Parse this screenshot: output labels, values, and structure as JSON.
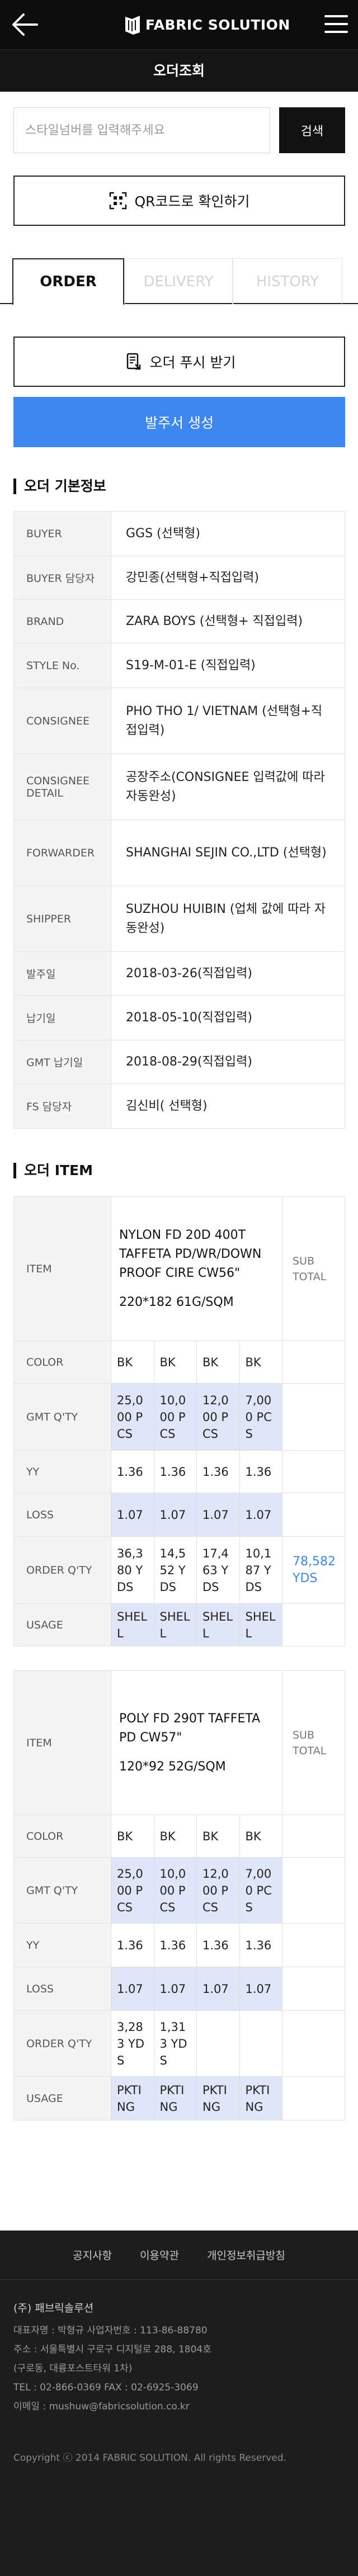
{
  "header": {
    "brand": "FABRIC SOLUTION",
    "page_title": "오더조회"
  },
  "search": {
    "placeholder": "스타일넘버를 입력해주세요",
    "button_label": "검색"
  },
  "qr_button_label": "QR코드로 확인하기",
  "tabs": [
    {
      "label": "ORDER",
      "active": true
    },
    {
      "label": "DELIVERY",
      "active": false
    },
    {
      "label": "HISTORY",
      "active": false
    }
  ],
  "push_button_label": "오더 푸시 받기",
  "create_button_label": "발주서 생성",
  "order_info": {
    "title": "오더 기본정보",
    "rows": [
      {
        "key": "BUYER",
        "value": "GGS (선택형)"
      },
      {
        "key": "BUYER 담당자",
        "value": "강민종(선택형+직접입력)"
      },
      {
        "key": "BRAND",
        "value": "ZARA BOYS (선택형+ 직접입력)"
      },
      {
        "key": "STYLE No.",
        "value": "S19-M-01-E (직접입력)"
      },
      {
        "key": "CONSIGNEE",
        "value": "PHO THO 1/ VIETNAM (선택형+직접입력)"
      },
      {
        "key": "CONSIGNEE DETAIL",
        "value": "공장주소(CONSIGNEE 입력값에 따라 자동완성)"
      },
      {
        "key": "FORWARDER",
        "value": "SHANGHAI SEJIN CO.,LTD (선택형)"
      },
      {
        "key": "SHIPPER",
        "value": "SUZHOU HUIBIN (업체 값에 따라 자동완성)"
      },
      {
        "key": "발주일",
        "value": "2018-03-26(직접입력)"
      },
      {
        "key": "납기일",
        "value": "2018-05-10(직접입력)"
      },
      {
        "key": "GMT 납기일",
        "value": "2018-08-29(직접입력)"
      },
      {
        "key": "FS 담당자",
        "value": "김신비( 선택형)"
      }
    ]
  },
  "order_item": {
    "title": "오더 ITEM",
    "labels": {
      "item": "ITEM",
      "sub_total": "SUB TOTAL",
      "color": "COLOR",
      "gmt_qty": "GMT Q'TY",
      "yy": "YY",
      "loss": "LOSS",
      "order_qty": "ORDER Q'TY",
      "usage": "USAGE"
    },
    "items": [
      {
        "spec_name": "NYLON FD 20D 400T TAFFETA PD/WR/DOWN PROOF CIRE CW56\"",
        "spec_detail": "220*182   61G/SQM",
        "colors": [
          "BK",
          "BK",
          "BK",
          "BK"
        ],
        "gmt_qty": [
          "25,000 PCS",
          "10,000 PCS",
          "12,000 PCS",
          "7,000 PCS"
        ],
        "yy": [
          "1.36",
          "1.36",
          "1.36",
          "1.36"
        ],
        "loss": [
          "1.07",
          "1.07",
          "1.07",
          "1.07"
        ],
        "order_qty": [
          "36,380 YDS",
          "14,552 YDS",
          "17,463 YDS",
          "10,187 YDS"
        ],
        "order_total": "78,582 YDS",
        "usage": [
          "SHELL",
          "SHELL",
          "SHELL",
          "SHELL"
        ]
      },
      {
        "spec_name": "POLY FD 290T TAFFETA PD CW57\"",
        "spec_detail": "120*92 52G/SQM",
        "colors": [
          "BK",
          "BK",
          "BK",
          "BK"
        ],
        "gmt_qty": [
          "25,000 PCS",
          "10,000 PCS",
          "12,000 PCS",
          "7,000 PCS"
        ],
        "yy": [
          "1.36",
          "1.36",
          "1.36",
          "1.36"
        ],
        "loss": [
          "1.07",
          "1.07",
          "1.07",
          "1.07"
        ],
        "order_qty": [
          "3,283 YDS",
          "1,313 YDS",
          "",
          ""
        ],
        "order_total": "",
        "usage": [
          "PKTING",
          "PKTING",
          "PKTING",
          "PKTING"
        ]
      }
    ]
  },
  "footer": {
    "links": [
      "공지사항",
      "이용약관",
      "개인정보취급방침"
    ],
    "company": "(주) 패브릭솔루션",
    "lines": [
      "대표자명 : 박형규    사업자번호 : 113-86-88780",
      "주소 : 서울특별시 구로구 디지털로 288, 1804호",
      "(구로동, 대륭포스트타워 1차)",
      "TEL : 02-866-0369      FAX : 02-6925-3069",
      "이메일 : mushuw@fabricsolution.co.kr"
    ],
    "copyright": "Copyright ⓒ 2014 FABRIC SOLUTION. All rights Reserved."
  },
  "colors": {
    "accent": "#3e86f0",
    "header_bg": "#0c0c0c",
    "highlight_row": "#dfe6f7"
  },
  "icons": [
    "back-arrow-icon",
    "brand-logo-icon",
    "hamburger-menu-icon",
    "qr-code-icon",
    "push-notification-icon"
  ]
}
